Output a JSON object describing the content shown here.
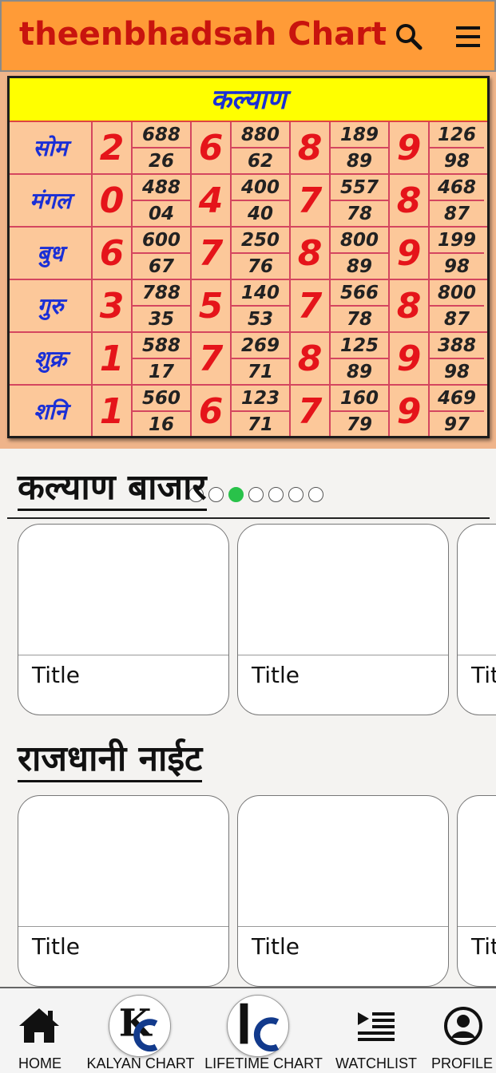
{
  "app": {
    "title": "theenbhadsah Chart"
  },
  "header_icons": {
    "search": "search-icon",
    "menu": "menu-icon"
  },
  "chart": {
    "heading": "कल्याण",
    "rows": [
      {
        "day": "सोम",
        "cols": [
          {
            "big": "2",
            "top": "688",
            "bot": "26"
          },
          {
            "big": "6",
            "top": "880",
            "bot": "62"
          },
          {
            "big": "8",
            "top": "189",
            "bot": "89"
          },
          {
            "big": "9",
            "top": "126",
            "bot": "98"
          }
        ]
      },
      {
        "day": "मंगल",
        "cols": [
          {
            "big": "0",
            "top": "488",
            "bot": "04"
          },
          {
            "big": "4",
            "top": "400",
            "bot": "40"
          },
          {
            "big": "7",
            "top": "557",
            "bot": "78"
          },
          {
            "big": "8",
            "top": "468",
            "bot": "87"
          }
        ]
      },
      {
        "day": "बुध",
        "cols": [
          {
            "big": "6",
            "top": "600",
            "bot": "67"
          },
          {
            "big": "7",
            "top": "250",
            "bot": "76"
          },
          {
            "big": "8",
            "top": "800",
            "bot": "89"
          },
          {
            "big": "9",
            "top": "199",
            "bot": "98"
          }
        ]
      },
      {
        "day": "गुरु",
        "cols": [
          {
            "big": "3",
            "top": "788",
            "bot": "35"
          },
          {
            "big": "5",
            "top": "140",
            "bot": "53"
          },
          {
            "big": "7",
            "top": "566",
            "bot": "78"
          },
          {
            "big": "8",
            "top": "800",
            "bot": "87"
          }
        ]
      },
      {
        "day": "शुक्र",
        "cols": [
          {
            "big": "1",
            "top": "588",
            "bot": "17"
          },
          {
            "big": "7",
            "top": "269",
            "bot": "71"
          },
          {
            "big": "8",
            "top": "125",
            "bot": "89"
          },
          {
            "big": "9",
            "top": "388",
            "bot": "98"
          }
        ]
      },
      {
        "day": "शनि",
        "cols": [
          {
            "big": "1",
            "top": "560",
            "bot": "16"
          },
          {
            "big": "6",
            "top": "123",
            "bot": "71"
          },
          {
            "big": "7",
            "top": "160",
            "bot": "79"
          },
          {
            "big": "9",
            "top": "469",
            "bot": "97"
          }
        ]
      }
    ],
    "carousel": {
      "count": 7,
      "active_index": 2
    }
  },
  "sections": [
    {
      "title": "कल्याण बाजार",
      "cards": [
        "Title",
        "Title",
        "Title"
      ]
    },
    {
      "title": "राजधानी नाईट",
      "cards": [
        "Title",
        "Title",
        "Title"
      ]
    }
  ],
  "nav": [
    {
      "label": "HOME",
      "icon": "home-icon"
    },
    {
      "label": "KALYAN CHART",
      "icon": "kc-logo-icon",
      "logo_text": "KC"
    },
    {
      "label": "LIFETIME CHART",
      "icon": "lc-logo-icon",
      "logo_text": "LC"
    },
    {
      "label": "WATCHLIST",
      "icon": "watchlist-icon"
    },
    {
      "label": "PROFILE",
      "icon": "profile-icon"
    }
  ],
  "colors": {
    "header_bg": "#ff9b37",
    "title_red": "#c8140e",
    "chart_blue": "#1a2fd6",
    "chart_red": "#e5141a",
    "chart_yellow": "#ffff00",
    "dot_active": "#29c24a"
  }
}
